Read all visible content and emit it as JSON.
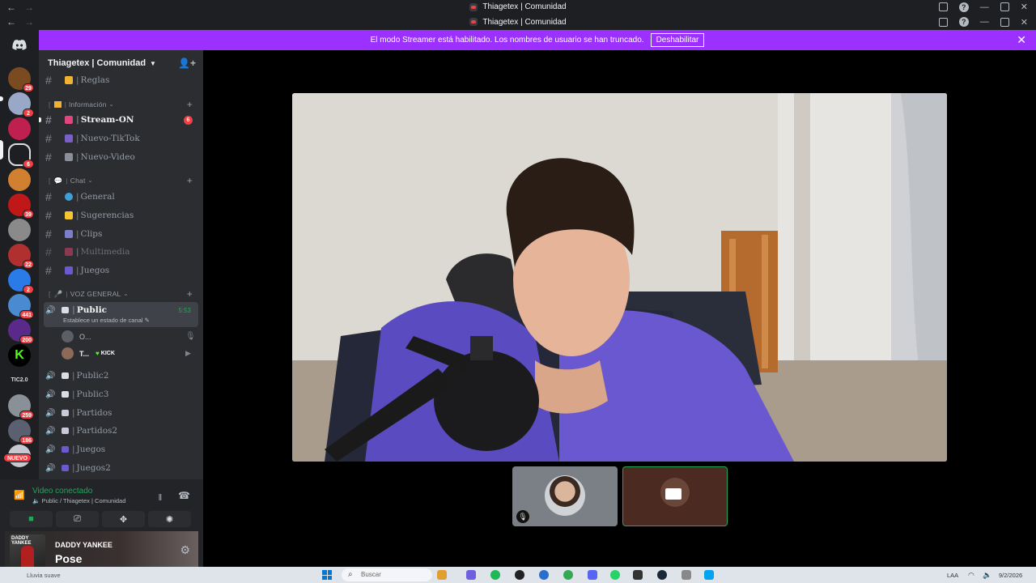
{
  "window": {
    "title": "Thiagetex | Comunidad",
    "title2": "Thiagetex | Comunidad"
  },
  "banner": {
    "message": "El modo Streamer está habilitado. Los nombres de usuario se han truncado.",
    "button": "Deshabilitar"
  },
  "server_rail": {
    "badges": [
      "29",
      "2",
      "",
      "6",
      "",
      "39",
      "",
      "22",
      "2",
      "441",
      "200",
      "",
      "",
      "259",
      "186",
      "NUEVO"
    ],
    "tic_label": "TIC2.0"
  },
  "server": {
    "name": "Thiagetex | Comunidad"
  },
  "channels": {
    "reglas": "Reglas",
    "cat_info": "Información",
    "stream_on": "Stream-ON",
    "stream_on_mentions": "6",
    "nuevo_tiktok": "Nuevo-TikTok",
    "nuevo_video": "Nuevo-Video",
    "cat_chat": "Chat",
    "general": "General",
    "sugerencias": "Sugerencias",
    "clips": "Clips",
    "multimedia": "Multimedia",
    "juegos": "Juegos",
    "cat_voz": "VOZ GENERAL",
    "public": "Public",
    "public_timer": "5:53",
    "public_status": "Establece un estado de canal",
    "user1": "O...",
    "user2": "T...",
    "user2_tag": "KICK",
    "public2": "Public2",
    "public3": "Public3",
    "partidos": "Partidos",
    "partidos2": "Partidos2",
    "juegos_voice": "Juegos",
    "juegos2": "Juegos2"
  },
  "voice": {
    "status": "Video conectado",
    "channel": "Public / Thiagetex | Comunidad"
  },
  "activity": {
    "artist": "DADDY YANKEE",
    "song": "Pose",
    "art_text": "DADDY YANKEE"
  },
  "taskbar": {
    "weather": "Lluvia suave",
    "search_placeholder": "Buscar",
    "lang": "LAA",
    "date": "9/2/2026"
  }
}
